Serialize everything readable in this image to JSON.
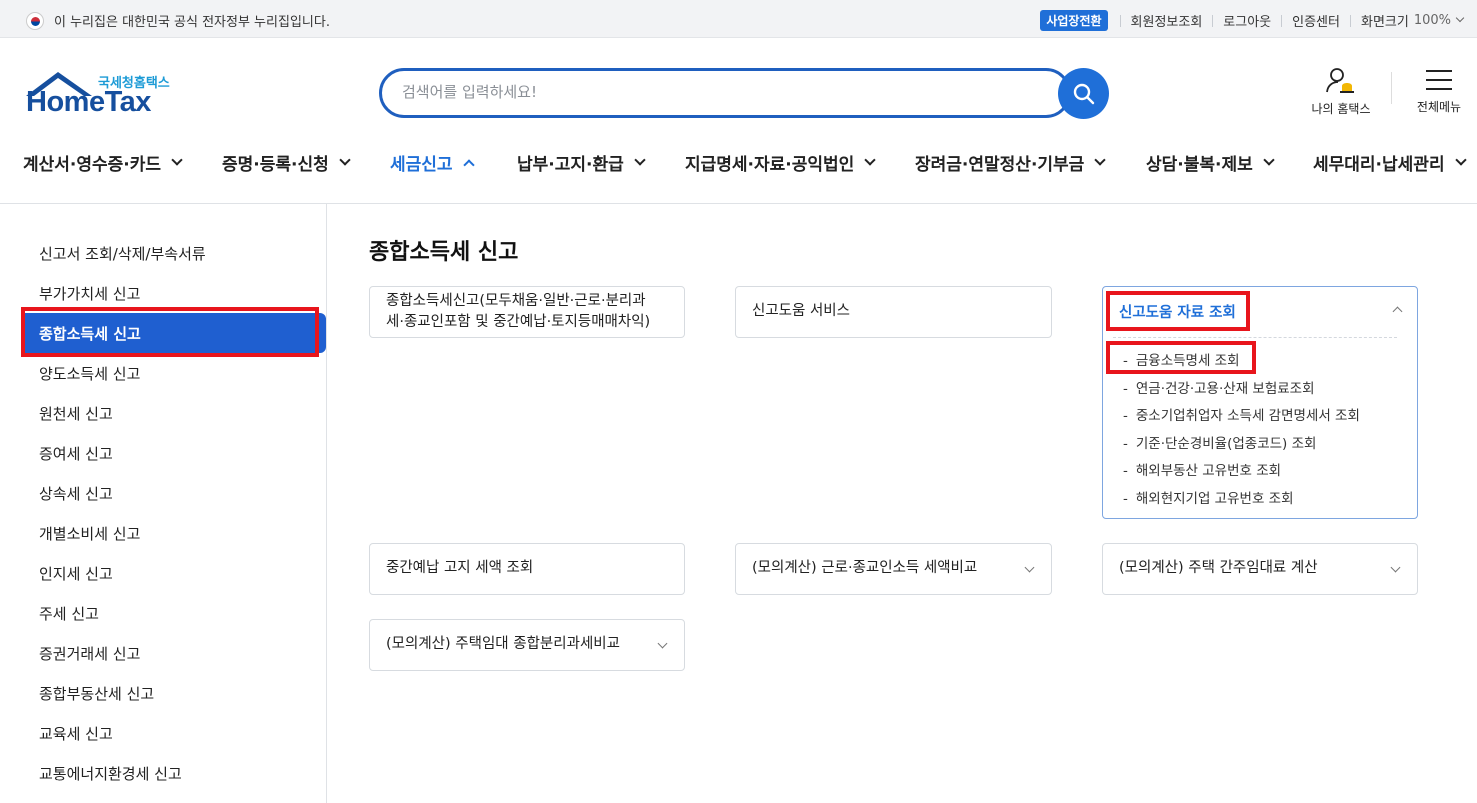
{
  "gov_notice": "이 누리집은 대한민국 공식 전자정부 누리집입니다.",
  "util": {
    "biz_switch": "사업장전환",
    "member_info": "회원정보조회",
    "logout": "로그아웃",
    "cert_center": "인증센터",
    "screen_size": "화면크기",
    "zoom": "100%"
  },
  "logo": {
    "sub": "국세청홈택스",
    "main": "HomeTax"
  },
  "search": {
    "placeholder": "검색어를 입력하세요!"
  },
  "header": {
    "my_hometax": "나의 홈택스",
    "all_menu": "전체메뉴"
  },
  "gnb": [
    {
      "label": "계산서·영수증·카드"
    },
    {
      "label": "증명·등록·신청"
    },
    {
      "label": "세금신고"
    },
    {
      "label": "납부·고지·환급"
    },
    {
      "label": "지급명세·자료·공익법인"
    },
    {
      "label": "장려금·연말정산·기부금"
    },
    {
      "label": "상담·불복·제보"
    },
    {
      "label": "세무대리·납세관리"
    }
  ],
  "lnb": [
    "신고서 조회/삭제/부속서류",
    "부가가치세 신고",
    "종합소득세 신고",
    "양도소득세 신고",
    "원천세 신고",
    "증여세 신고",
    "상속세 신고",
    "개별소비세 신고",
    "인지세 신고",
    "주세 신고",
    "증권거래세 신고",
    "종합부동산세 신고",
    "교육세 신고",
    "교통에너지환경세 신고"
  ],
  "page_title": "종합소득세 신고",
  "cards": {
    "c1_line1": "종합소득세신고(모두채움·일반·근로·분리과",
    "c1_line2": "세·종교인포함 및 중간예납·토지등매매차익)",
    "c2": "신고도움 서비스",
    "c3_title": "신고도움 자료 조회",
    "c3_items": [
      "금융소득명세 조회",
      "연금·건강·고용·산재 보험료조회",
      "중소기업취업자 소득세 감면명세서 조회",
      "기준·단순경비율(업종코드) 조회",
      "해외부동산 고유번호 조회",
      "해외현지기업 고유번호 조회"
    ],
    "c4": "중간예납 고지 세액 조회",
    "c5": "(모의계산) 근로·종교인소득 세액비교",
    "c6": "(모의계산) 주택 간주임대료 계산",
    "c7": "(모의계산) 주택임대 종합분리과세비교"
  },
  "colors": {
    "primary": "#1f6fd8",
    "nav_active_bg": "#1f5fd0",
    "highlight": "#e8151c"
  }
}
